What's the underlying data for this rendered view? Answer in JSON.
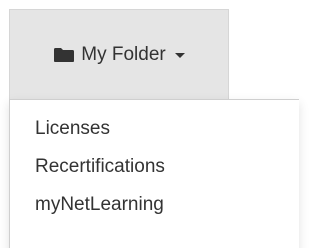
{
  "dropdown": {
    "toggle_label": "My Folder",
    "toggle_icon": "folder-icon",
    "caret_icon": "caret-down-icon",
    "items": [
      {
        "label": "Licenses"
      },
      {
        "label": "Recertifications"
      },
      {
        "label": "myNetLearning"
      }
    ]
  },
  "colors": {
    "toggle_background": "#e5e5e5",
    "text": "#333333",
    "menu_background": "#ffffff",
    "border": "#cfcfcf"
  }
}
